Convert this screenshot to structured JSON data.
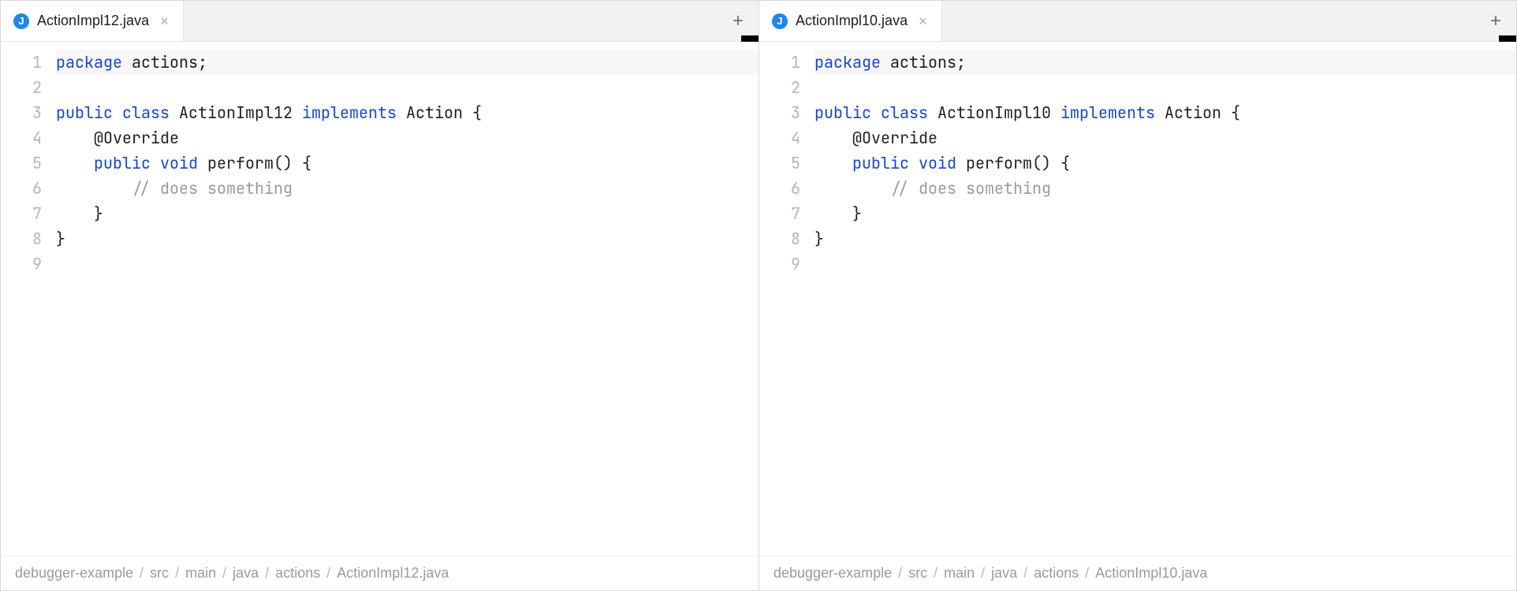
{
  "panes": [
    {
      "tab": {
        "iconLetter": "J",
        "filename": "ActionImpl12.java"
      },
      "lines": [
        {
          "n": 1,
          "hl": true,
          "tokens": [
            {
              "t": "package ",
              "c": "kw"
            },
            {
              "t": "actions;"
            }
          ]
        },
        {
          "n": 2,
          "tokens": []
        },
        {
          "n": 3,
          "tokens": [
            {
              "t": "public class ",
              "c": "kw"
            },
            {
              "t": "ActionImpl12 "
            },
            {
              "t": "implements ",
              "c": "kw"
            },
            {
              "t": "Action {"
            }
          ]
        },
        {
          "n": 4,
          "tokens": [
            {
              "t": "    @Override"
            }
          ]
        },
        {
          "n": 5,
          "tokens": [
            {
              "t": "    "
            },
            {
              "t": "public void ",
              "c": "kw"
            },
            {
              "t": "perform() {"
            }
          ]
        },
        {
          "n": 6,
          "tokens": [
            {
              "t": "        "
            },
            {
              "t": "// does something",
              "c": "cm"
            }
          ]
        },
        {
          "n": 7,
          "tokens": [
            {
              "t": "    }"
            }
          ]
        },
        {
          "n": 8,
          "tokens": [
            {
              "t": "}"
            }
          ]
        },
        {
          "n": 9,
          "tokens": []
        }
      ],
      "breadcrumb": [
        "debugger-example",
        "src",
        "main",
        "java",
        "actions",
        "ActionImpl12.java"
      ]
    },
    {
      "tab": {
        "iconLetter": "J",
        "filename": "ActionImpl10.java"
      },
      "lines": [
        {
          "n": 1,
          "hl": true,
          "tokens": [
            {
              "t": "package ",
              "c": "kw"
            },
            {
              "t": "actions;"
            }
          ]
        },
        {
          "n": 2,
          "tokens": []
        },
        {
          "n": 3,
          "tokens": [
            {
              "t": "public class ",
              "c": "kw"
            },
            {
              "t": "ActionImpl10 "
            },
            {
              "t": "implements ",
              "c": "kw"
            },
            {
              "t": "Action {"
            }
          ]
        },
        {
          "n": 4,
          "tokens": [
            {
              "t": "    @Override"
            }
          ]
        },
        {
          "n": 5,
          "tokens": [
            {
              "t": "    "
            },
            {
              "t": "public void ",
              "c": "kw"
            },
            {
              "t": "perform() {"
            }
          ]
        },
        {
          "n": 6,
          "tokens": [
            {
              "t": "        "
            },
            {
              "t": "// does something",
              "c": "cm"
            }
          ]
        },
        {
          "n": 7,
          "tokens": [
            {
              "t": "    }"
            }
          ]
        },
        {
          "n": 8,
          "tokens": [
            {
              "t": "}"
            }
          ]
        },
        {
          "n": 9,
          "tokens": []
        }
      ],
      "breadcrumb": [
        "debugger-example",
        "src",
        "main",
        "java",
        "actions",
        "ActionImpl10.java"
      ]
    }
  ],
  "glyphs": {
    "close": "×",
    "add": "+",
    "sep": "/"
  }
}
